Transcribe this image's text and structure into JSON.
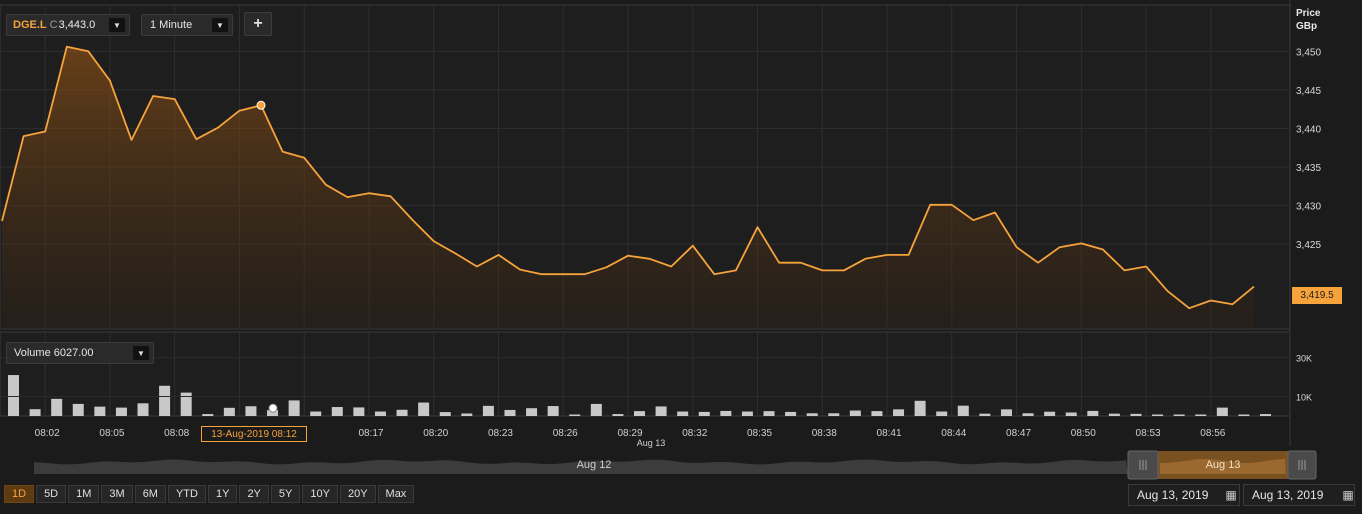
{
  "toolbar": {
    "symbol": "DGE.L",
    "close_prefix": "C",
    "close_value": "3,443.0",
    "interval": "1 Minute",
    "add_label": "+"
  },
  "axis": {
    "price_title_line1": "Price",
    "price_title_line2": "GBp",
    "last_price": "3,419.5",
    "crosshair_time": "13-Aug-2019 08:12",
    "date_label": "Aug 13"
  },
  "volume": {
    "label": "Volume 6027.00"
  },
  "navigator": {
    "left_label": "Aug 12",
    "right_label": "Aug 13"
  },
  "range_buttons": [
    "1D",
    "5D",
    "1M",
    "3M",
    "6M",
    "YTD",
    "1Y",
    "2Y",
    "5Y",
    "10Y",
    "20Y",
    "Max"
  ],
  "active_range": "1D",
  "date_from": "Aug 13, 2019",
  "date_to": "Aug 13, 2019",
  "colors": {
    "accent": "#f7a33b",
    "background": "#1b1b1b",
    "volume_bar": "#c8c8c8"
  },
  "chart_data": [
    {
      "type": "area",
      "title": "",
      "xlabel": "",
      "ylabel": "Price GBp",
      "ylim": [
        3414,
        3456
      ],
      "yticks": [
        "3,450",
        "3,445",
        "3,440",
        "3,435",
        "3,430",
        "3,425"
      ],
      "xticks": [
        "08:02",
        "08:05",
        "08:08",
        "08:17",
        "08:20",
        "08:23",
        "08:26",
        "08:29",
        "08:32",
        "08:35",
        "08:38",
        "08:41",
        "08:44",
        "08:47",
        "08:50",
        "08:53",
        "08:56"
      ],
      "x_first": "08:00",
      "x_step_minutes": 1,
      "grid": true,
      "series": [
        {
          "values": [
            3428.0,
            3439.0,
            3439.6,
            3450.6,
            3450.0,
            3446.2,
            3438.5,
            3444.2,
            3443.8,
            3438.6,
            3440.1,
            3442.3,
            3443.0,
            3437.0,
            3436.2,
            3432.7,
            3431.1,
            3431.6,
            3431.2,
            3428.2,
            3425.4,
            3423.8,
            3422.1,
            3423.6,
            3421.7,
            3421.1,
            3421.1,
            3421.1,
            3422.0,
            3423.5,
            3423.1,
            3422.1,
            3424.8,
            3421.1,
            3421.6,
            3427.2,
            3422.6,
            3422.6,
            3421.6,
            3421.6,
            3423.1,
            3423.6,
            3423.6,
            3430.1,
            3430.1,
            3428.1,
            3429.1,
            3424.6,
            3422.6,
            3424.6,
            3425.1,
            3424.3,
            3421.6,
            3422.1,
            3418.9,
            3416.7,
            3417.7,
            3417.2,
            3419.5
          ]
        }
      ],
      "highlight": {
        "x": "08:12",
        "y": 3443.0
      }
    },
    {
      "type": "bar",
      "title": "",
      "ylabel": "Volume",
      "ylim": [
        0,
        40000
      ],
      "yticks": [
        "30K",
        "10K"
      ],
      "series": [
        {
          "values": [
            21000,
            3500,
            8800,
            6200,
            4800,
            4300,
            6500,
            15500,
            12000,
            1000,
            4200,
            5000,
            3000,
            8000,
            2300,
            4600,
            4400,
            2300,
            3200,
            6900,
            2000,
            1300,
            5200,
            3100,
            4000,
            5100,
            700,
            6200,
            1000,
            2500,
            4900,
            2300,
            2100,
            2600,
            2300,
            2500,
            2100,
            1400,
            1400,
            2800,
            2500,
            3400,
            7800,
            2300,
            5300,
            1200,
            3400,
            1400,
            2200,
            1800,
            2600,
            1200,
            1100,
            500,
            500,
            500,
            4300,
            0,
            1000
          ]
        }
      ]
    }
  ]
}
